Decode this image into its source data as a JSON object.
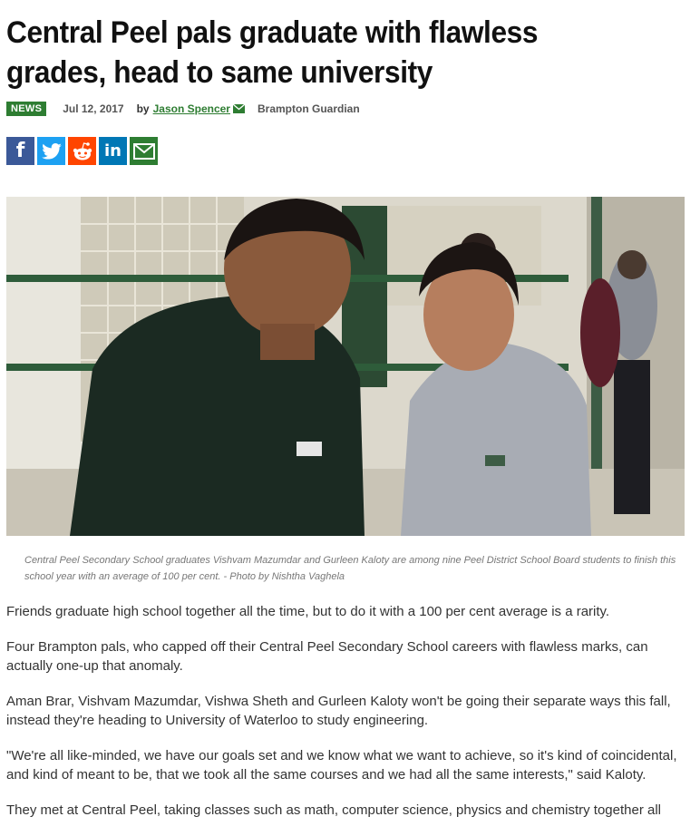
{
  "article": {
    "title": "Central Peel pals graduate with flawless grades, head to same university",
    "category_badge": "NEWS",
    "date": "Jul 12, 2017",
    "by_label": "by",
    "author": "Jason Spencer",
    "source": "Brampton Guardian",
    "share_icons": [
      "facebook-icon",
      "twitter-icon",
      "reddit-icon",
      "linkedin-icon",
      "email-icon"
    ],
    "share_glyphs": {
      "facebook": "f",
      "linkedin": "in"
    },
    "caption": "Central Peel Secondary School graduates Vishvam Mazumdar and Gurleen Kaloty are among nine Peel District School Board students to finish this school year with an average of 100 per cent. - Photo by Nishtha Vaghela",
    "paragraphs": [
      "Friends graduate high school together all the time, but to do it with a 100 per cent average is a rarity.",
      "Four Brampton pals, who capped off their Central Peel Secondary School careers with flawless marks, can actually one-up that anomaly.",
      "Aman Brar, Vishvam Mazumdar, Vishwa Sheth and Gurleen Kaloty won't be going their separate ways this fall, instead they're heading to University of Waterloo to study engineering.",
      "\"We're all like-minded, we have our goals set and we know what we want to achieve, so it's kind of coincidental, and kind of meant to be, that we took all the same courses and we had all the same interests,\" said Kaloty.",
      "They met at Central Peel, taking classes such as math, computer science, physics and chemistry together all"
    ]
  },
  "colors": {
    "accent_green": "#2e7d32",
    "facebook": "#3b5998",
    "twitter": "#1da1f2",
    "reddit": "#ff4500",
    "linkedin": "#0077b5"
  }
}
